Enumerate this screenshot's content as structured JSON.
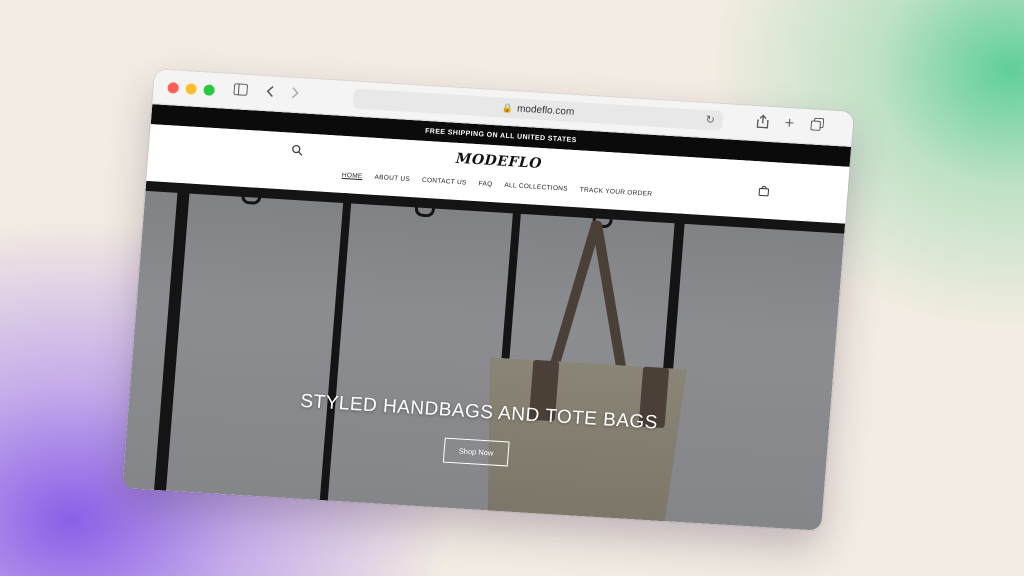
{
  "browser": {
    "url": "modeflo.com",
    "traffic_lights": {
      "close": "#ff5f57",
      "minimize": "#febc2e",
      "zoom": "#28c840"
    },
    "icons": [
      "sidebar-icon",
      "back-icon",
      "forward-icon",
      "lock-icon",
      "reload-icon",
      "share-icon",
      "new-tab-icon",
      "tabs-icon"
    ]
  },
  "site": {
    "announcement": "FREE SHIPPING ON ALL UNITED STATES",
    "logo": "MODEFLO",
    "nav": [
      "HOME",
      "ABOUT US",
      "CONTACT US",
      "FAQ",
      "ALL COLLECTIONS",
      "TRACK YOUR ORDER"
    ],
    "active_nav": "HOME",
    "hero": {
      "title": "STYLED HANDBAGS AND TOTE BAGS",
      "button": "Shop Now"
    }
  },
  "colors": {
    "announcement_bg": "#0b0b0b",
    "hero_bg": "#85878a",
    "bag": "#857f71"
  }
}
